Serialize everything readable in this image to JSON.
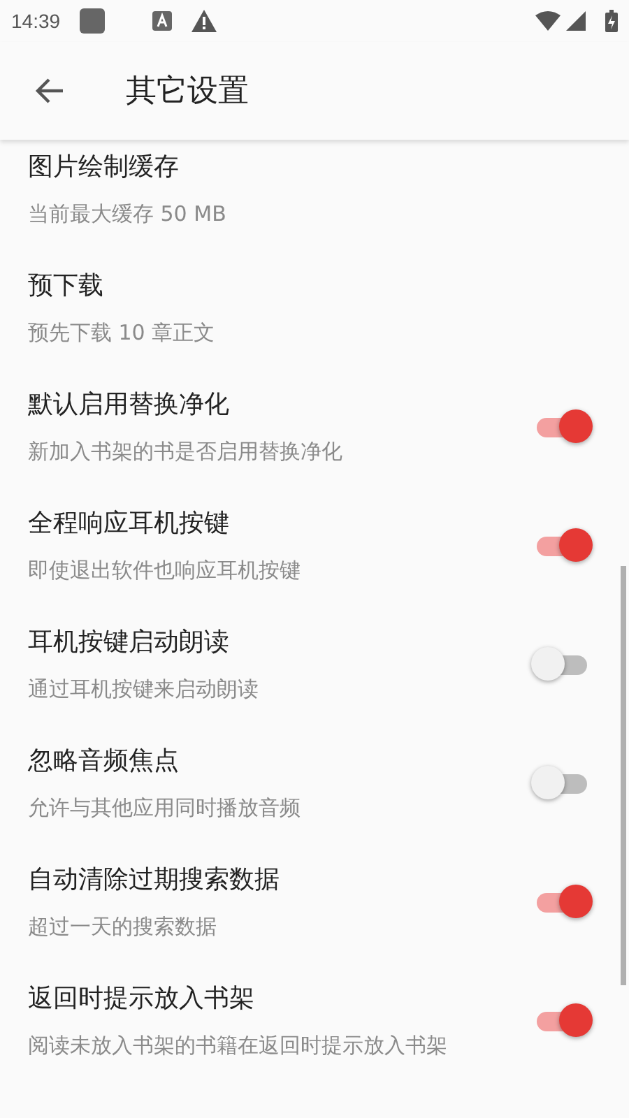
{
  "status_bar": {
    "time": "14:39"
  },
  "toolbar": {
    "title": "其它设置"
  },
  "settings": [
    {
      "kind": "text",
      "title": "图片绘制缓存",
      "summary": "当前最大缓存 50 MB"
    },
    {
      "kind": "text",
      "title": "预下载",
      "summary": "预先下载 10 章正文"
    },
    {
      "kind": "switch",
      "title": "默认启用替换净化",
      "summary": "新加入书架的书是否启用替换净化",
      "on": true
    },
    {
      "kind": "switch",
      "title": "全程响应耳机按键",
      "summary": "即使退出软件也响应耳机按键",
      "on": true
    },
    {
      "kind": "switch",
      "title": "耳机按键启动朗读",
      "summary": "通过耳机按键来启动朗读",
      "on": false
    },
    {
      "kind": "switch",
      "title": "忽略音频焦点",
      "summary": "允许与其他应用同时播放音频",
      "on": false
    },
    {
      "kind": "switch",
      "title": "自动清除过期搜索数据",
      "summary": "超过一天的搜索数据",
      "on": true
    },
    {
      "kind": "switch",
      "title": "返回时提示放入书架",
      "summary": "阅读未放入书架的书籍在返回时提示放入书架",
      "on": true
    }
  ]
}
